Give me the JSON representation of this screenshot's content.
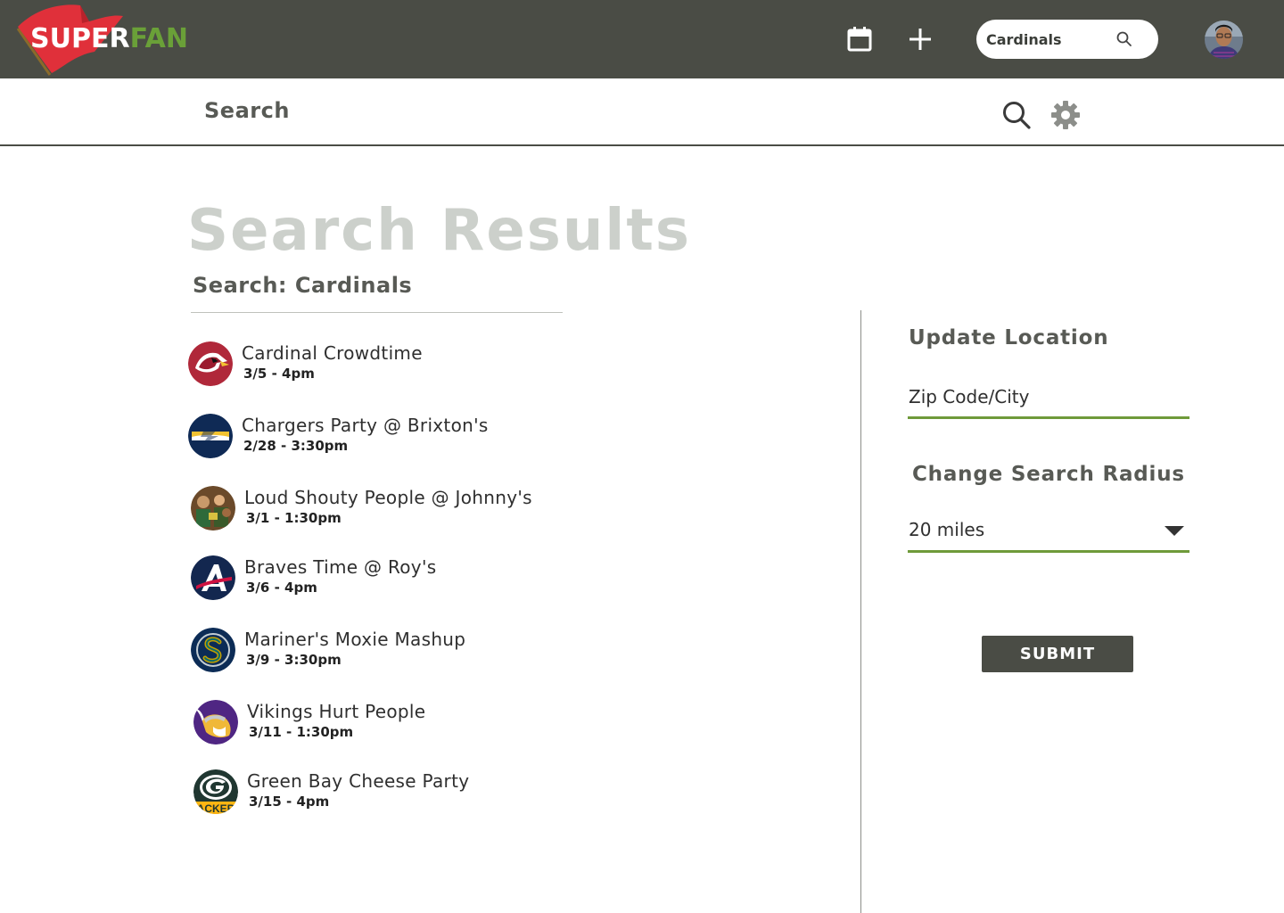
{
  "app": {
    "logo_primary": "SUPER",
    "logo_accent": "FAN",
    "colors": {
      "bar": "#4a4c45",
      "accent_green": "#6aa038",
      "flag_red": "#e0303a",
      "title_gray": "#ccd0cb"
    }
  },
  "header": {
    "search_value": "Cardinals",
    "icons": {
      "calendar": "calendar-icon",
      "add": "plus-icon",
      "search": "search-icon"
    }
  },
  "subbar": {
    "title": "Search"
  },
  "main": {
    "title": "Search Results",
    "query_label": "Search: Cardinals",
    "results": [
      {
        "name": "Cardinal Crowdtime",
        "date": "3/5 - 4pm"
      },
      {
        "name": "Chargers Party @ Brixton's",
        "date": "2/28 - 3:30pm"
      },
      {
        "name": "Loud Shouty People @ Johnny's",
        "date": "3/1 - 1:30pm"
      },
      {
        "name": "Braves Time @ Roy's",
        "date": "3/6 - 4pm"
      },
      {
        "name": "Mariner's Moxie Mashup",
        "date": "3/9 - 3:30pm"
      },
      {
        "name": "Vikings Hurt People",
        "date": "3/11 - 1:30pm"
      },
      {
        "name": "Green Bay Cheese Party",
        "date": "3/15 - 4pm"
      }
    ]
  },
  "sidebar": {
    "location_heading": "Update Location",
    "location_placeholder": "Zip Code/City",
    "radius_heading": "Change Search Radius",
    "radius_value": "20 miles",
    "submit_label": "SUBMIT"
  }
}
